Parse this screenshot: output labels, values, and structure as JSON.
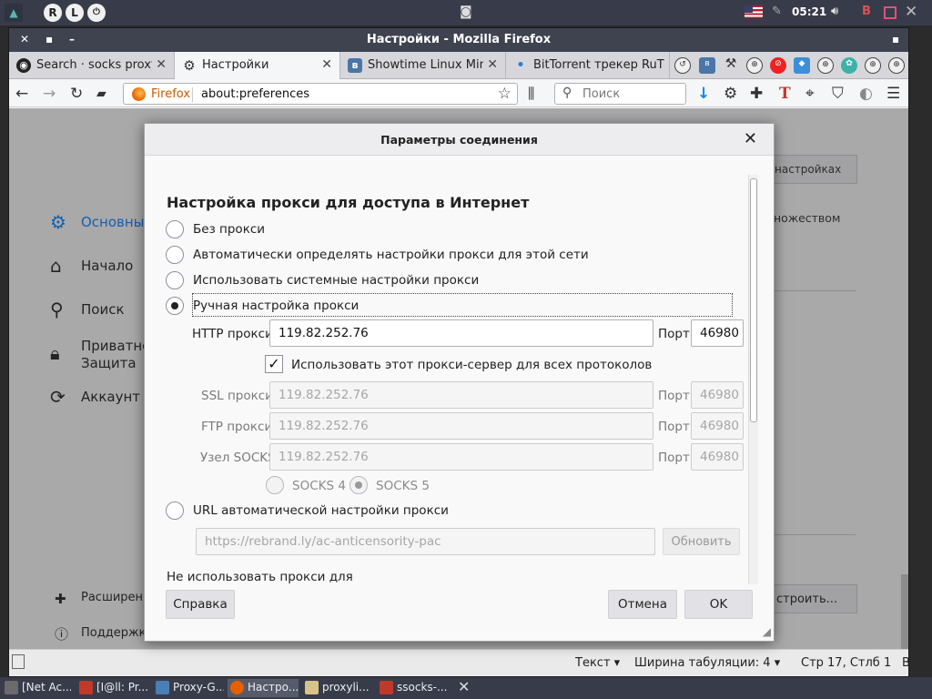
{
  "system_panel": {
    "launcher_icons": [
      "R",
      "L"
    ],
    "clock": "05:21"
  },
  "window": {
    "title": "Настройки - Mozilla Firefox"
  },
  "tabs": [
    {
      "label": "Search · socks proxy ·",
      "icon": "github-icon"
    },
    {
      "label": "Настройки",
      "icon": "gear-icon"
    },
    {
      "label": "Showtime Linux Mint",
      "icon": "vk-icon"
    },
    {
      "label": "BitTorrent трекер RuT",
      "icon": "dot-icon"
    }
  ],
  "navbar": {
    "identity_label": "Firefox",
    "url": "about:preferences",
    "search_placeholder": "Поиск"
  },
  "prefs_sidebar": [
    {
      "label": "Основные",
      "icon": "gear-icon",
      "active": true
    },
    {
      "label": "Начало",
      "icon": "home-icon"
    },
    {
      "label": "Поиск",
      "icon": "search-icon"
    },
    {
      "label": "Приватность\nЗащита",
      "icon": "lock-icon"
    },
    {
      "label": "Аккаунт Firefox",
      "icon": "sync-icon"
    }
  ],
  "prefs_sidebar_bottom": [
    {
      "label": "Расширения",
      "icon": "puzzle-icon"
    },
    {
      "label": "Поддержка",
      "icon": "help-icon"
    }
  ],
  "prefs_right_fragments": {
    "top_button": "настройках",
    "mid_text": "ножеством",
    "bottom_button": "строить..."
  },
  "statusbar": {
    "text_mode": "Текст",
    "tab_width_label": "Ширина табуляции:",
    "tab_width_value": "4",
    "position": "Стр 17, Стлб 1",
    "insert_mode": "ВСТ"
  },
  "dialog": {
    "title": "Параметры соединения",
    "heading": "Настройка прокси для доступа в Интернет",
    "options": [
      {
        "label": "Без прокси",
        "checked": false
      },
      {
        "label": "Автоматически определять настройки прокси для этой сети",
        "checked": false
      },
      {
        "label": "Использовать системные настройки прокси",
        "checked": false
      },
      {
        "label": "Ручная настройка прокси",
        "checked": true
      }
    ],
    "http": {
      "label": "HTTP прокси",
      "host": "119.82.252.76",
      "port_label": "Порт",
      "port": "46980"
    },
    "use_for_all": {
      "label": "Использовать этот прокси-сервер для всех протоколов",
      "checked": true
    },
    "ssl": {
      "label": "SSL прокси",
      "host": "119.82.252.76",
      "port_label": "Порт",
      "port": "46980"
    },
    "ftp": {
      "label": "FTP прокси",
      "host": "119.82.252.76",
      "port_label": "Порт",
      "port": "46980"
    },
    "socks": {
      "label": "Узел SOCKS",
      "host": "119.82.252.76",
      "port_label": "Порт",
      "port": "46980"
    },
    "socks_versions": [
      {
        "label": "SOCKS 4",
        "checked": false
      },
      {
        "label": "SOCKS 5",
        "checked": true
      }
    ],
    "pac": {
      "label": "URL автоматической настройки прокси",
      "placeholder": "https://rebrand.ly/ac-anticensority-pac",
      "reload_label": "Обновить"
    },
    "no_proxy_label": "Не использовать прокси для",
    "buttons": {
      "help": "Справка",
      "cancel": "Отмена",
      "ok": "OK"
    }
  },
  "taskbar": [
    {
      "label": "[Net Ac...",
      "color": "#6b6b6b"
    },
    {
      "label": "[I@ll: Pr...",
      "color": "#c0392b"
    },
    {
      "label": "Proxy-G...",
      "color": "#4a7fb5"
    },
    {
      "label": "Настро...",
      "color": "#e66000",
      "active": true
    },
    {
      "label": "proxyli...",
      "color": "#d8c48a"
    },
    {
      "label": "ssocks-...",
      "color": "#c0392b"
    }
  ]
}
